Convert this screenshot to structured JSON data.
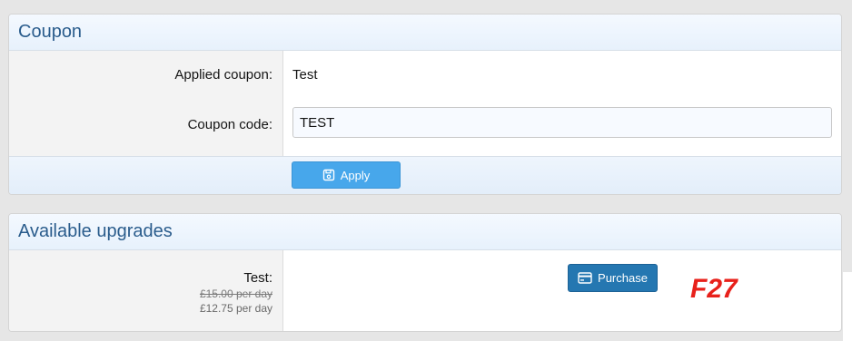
{
  "coupon": {
    "title": "Coupon",
    "applied_label": "Applied coupon:",
    "applied_value": "Test",
    "code_label": "Coupon code:",
    "code_value": "TEST",
    "apply_label": "Apply"
  },
  "upgrades": {
    "title": "Available upgrades",
    "items": [
      {
        "name": "Test:",
        "old_price": "£15.00 per day",
        "new_price": "£12.75 per day",
        "purchase_label": "Purchase"
      }
    ]
  },
  "watermark": {
    "text": "F27",
    "color": "#e8211b"
  },
  "colors": {
    "header_text": "#2a5c8c",
    "apply_button": "#47a7eb",
    "purchase_button": "#2577b1"
  },
  "icons": {
    "apply": "floppy-disk-icon",
    "purchase": "credit-card-icon"
  }
}
